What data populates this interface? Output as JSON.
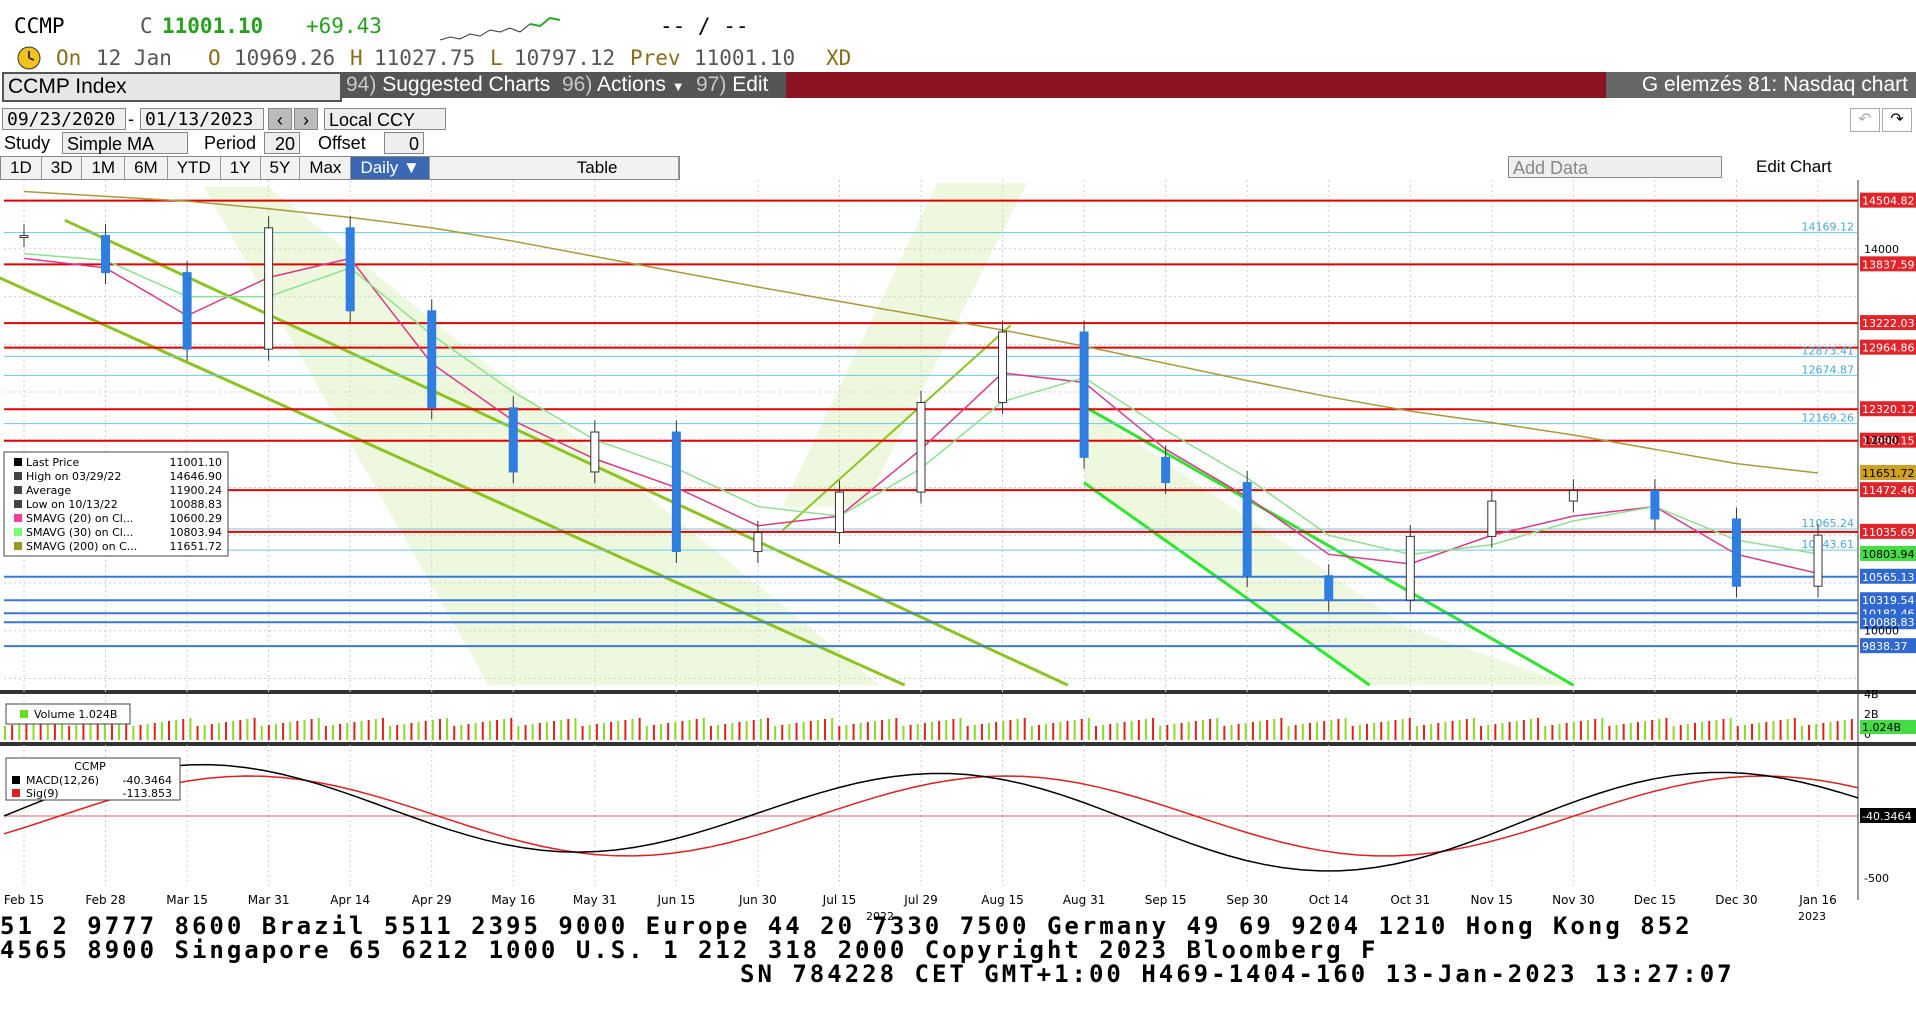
{
  "header": {
    "ticker": "CCMP",
    "c_label": "C",
    "close": "11001.10",
    "change": "+69.43",
    "bid_ask": "-- / --",
    "on_label": "On",
    "date": "12 Jan",
    "o_label": "O",
    "open": "10969.26",
    "h_label": "H",
    "high": "11027.75",
    "l_label": "L",
    "low": "10797.12",
    "prev_label": "Prev",
    "prev": "11001.10",
    "xd": "XD"
  },
  "toolbar": {
    "security": "CCMP Index",
    "m1_num": "94)",
    "m1": "Suggested Charts",
    "m2_num": "96)",
    "m2": "Actions",
    "m3_num": "97)",
    "m3": "Edit",
    "title": "G elemzés 81: Nasdaq chart"
  },
  "controls": {
    "start_date": "09/23/2020",
    "end_date": "01/13/2023",
    "currency": "Local CCY",
    "study_label": "Study",
    "study": "Simple MA",
    "period_label": "Period",
    "period": "20",
    "offset_label": "Offset",
    "offset": "0",
    "ranges": [
      "1D",
      "3D",
      "1M",
      "6M",
      "YTD",
      "1Y",
      "5Y",
      "Max"
    ],
    "frequency": "Daily",
    "table": "Table",
    "add_data": "Add Data",
    "edit_chart": "Edit Chart"
  },
  "legend": {
    "items": [
      {
        "label": "Last Price",
        "value": "11001.10",
        "color": "#000000"
      },
      {
        "label": "High on 03/29/22",
        "value": "14646.90",
        "color": "#444444"
      },
      {
        "label": "Average",
        "value": "11900.24",
        "color": "#444444"
      },
      {
        "label": "Low on 10/13/22",
        "value": "10088.83",
        "color": "#444444"
      },
      {
        "label": "SMAVG (20)  on Cl...",
        "value": "10600.29",
        "color": "#ff3aa0"
      },
      {
        "label": "SMAVG (30)  on Cl...",
        "value": "10803.94",
        "color": "#77ff77"
      },
      {
        "label": "SMAVG (200)  on C...",
        "value": "11651.72",
        "color": "#9a9a2a"
      }
    ],
    "volume_label": "Volume 1.024B",
    "macd_title": "CCMP",
    "macd": {
      "label": "MACD(12,26)",
      "value": "-40.3464"
    },
    "sig": {
      "label": "Sig(9)",
      "value": "-113.853"
    }
  },
  "axis": {
    "price_ticks": [
      "14000",
      "12000",
      "10000"
    ],
    "volume_ticks": [
      "4B",
      "2B",
      "0"
    ],
    "macd_ticks": [
      "-500"
    ],
    "macd_tag": "-40.3464",
    "volume_tag": "1.024B",
    "x_ticks": [
      "Feb 15",
      "Feb 28",
      "Mar 15",
      "Mar 31",
      "Apr 14",
      "Apr 29",
      "May 16",
      "May 31",
      "Jun 15",
      "Jun 30",
      "Jul 15",
      "Jul 29",
      "Aug 15",
      "Aug 31",
      "Sep 15",
      "Sep 30",
      "Oct 14",
      "Oct 31",
      "Nov 15",
      "Nov 30",
      "Dec 15",
      "Dec 30",
      "Jan 16"
    ],
    "year_2022": "2022",
    "year_2023": "2023"
  },
  "levels": [
    {
      "value": "14504.82",
      "type": "red"
    },
    {
      "value": "14169.12",
      "type": "cyan"
    },
    {
      "value": "13837.59",
      "type": "red"
    },
    {
      "value": "13222.03",
      "type": "red"
    },
    {
      "value": "12964.86",
      "type": "red"
    },
    {
      "value": "12873.41",
      "type": "cyan"
    },
    {
      "value": "12674.87",
      "type": "cyan"
    },
    {
      "value": "12320.12",
      "type": "red"
    },
    {
      "value": "12169.26",
      "type": "cyan"
    },
    {
      "value": "11990.15",
      "type": "red"
    },
    {
      "value": "11651.72",
      "type": "olive"
    },
    {
      "value": "11472.46",
      "type": "red"
    },
    {
      "value": "11065.24",
      "type": "cyan"
    },
    {
      "value": "11035.69",
      "type": "red"
    },
    {
      "value": "10843.61",
      "type": "cyan"
    },
    {
      "value": "10803.94",
      "type": "green"
    },
    {
      "value": "10565.13",
      "type": "blue"
    },
    {
      "value": "10319.54",
      "type": "blue"
    },
    {
      "value": "10182.46",
      "type": "blue"
    },
    {
      "value": "10088.83",
      "type": "blue"
    },
    {
      "value": "9838.37",
      "type": "blue"
    }
  ],
  "chart_data": {
    "type": "candlestick",
    "title": "CCMP Index",
    "x_range": [
      "Feb 2022",
      "Jan 2023"
    ],
    "ylim": [
      9400,
      14700
    ],
    "x": [
      "Feb 15",
      "Feb 28",
      "Mar 15",
      "Mar 31",
      "Apr 14",
      "Apr 29",
      "May 16",
      "May 31",
      "Jun 15",
      "Jun 30",
      "Jul 15",
      "Jul 29",
      "Aug 15",
      "Aug 31",
      "Sep 15",
      "Sep 30",
      "Oct 14",
      "Oct 31",
      "Nov 15",
      "Nov 30",
      "Dec 15",
      "Dec 30",
      "Jan 12"
    ],
    "close": [
      14139,
      13751,
      12949,
      14220,
      13351,
      12335,
      11663,
      12081,
      10829,
      11028,
      11452,
      12391,
      13129,
      11816,
      11552,
      10576,
      10321,
      10988,
      11358,
      11468,
      11170,
      10466,
      11001
    ],
    "series": [
      {
        "name": "SMAVG (20)",
        "values": [
          13900,
          13800,
          13300,
          13700,
          13900,
          12800,
          12200,
          11800,
          11500,
          11100,
          11200,
          11900,
          12700,
          12600,
          11900,
          11400,
          10800,
          10700,
          11000,
          11200,
          11300,
          10800,
          10600
        ]
      },
      {
        "name": "SMAVG (30)",
        "values": [
          13950,
          13880,
          13500,
          13500,
          13800,
          13100,
          12500,
          12000,
          11700,
          11300,
          11200,
          11700,
          12400,
          12650,
          12100,
          11600,
          11000,
          10800,
          10900,
          11150,
          11300,
          10950,
          10804
        ]
      },
      {
        "name": "SMAVG (200)",
        "values": [
          14600,
          14550,
          14500,
          14420,
          14330,
          14220,
          14080,
          13920,
          13760,
          13600,
          13450,
          13300,
          13150,
          12980,
          12800,
          12620,
          12450,
          12300,
          12180,
          12050,
          11900,
          11750,
          11652
        ]
      }
    ],
    "volume_ylim": [
      0,
      4
    ],
    "macd_ylim": [
      -600,
      600
    ]
  }
}
